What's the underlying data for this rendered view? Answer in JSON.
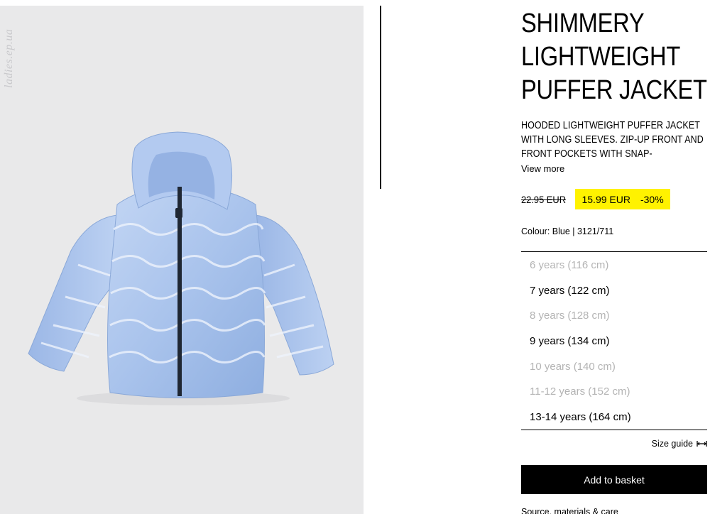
{
  "watermark": "ladies.ep.ua",
  "product": {
    "title": "SHIMMERY LIGHTWEIGHT PUFFER JACKET",
    "description": "HOODED LIGHTWEIGHT PUFFER JACKET WITH LONG SLEEVES. ZIP-UP FRONT AND FRONT POCKETS WITH SNAP-",
    "view_more": "View more",
    "old_price": "22.95 EUR",
    "new_price": "15.99 EUR",
    "discount": "-30%",
    "colour": "Colour: Blue | 3121/711"
  },
  "sizes": [
    {
      "label": "6 years (116 cm)",
      "available": false
    },
    {
      "label": "7 years (122 cm)",
      "available": true
    },
    {
      "label": "8 years (128 cm)",
      "available": false
    },
    {
      "label": "9 years (134 cm)",
      "available": true
    },
    {
      "label": "10 years (140 cm)",
      "available": false
    },
    {
      "label": "11-12 years (152 cm)",
      "available": false
    },
    {
      "label": "13-14 years (164 cm)",
      "available": true
    }
  ],
  "size_guide": "Size guide",
  "add_to_basket": "Add to basket",
  "source_link": "Source, materials & care",
  "colors": {
    "sale_highlight": "#fff200",
    "jacket": "#a9c3ec",
    "unavailable": "#b4b4b4"
  },
  "icons": {
    "size_guide": "ruler-icon"
  }
}
